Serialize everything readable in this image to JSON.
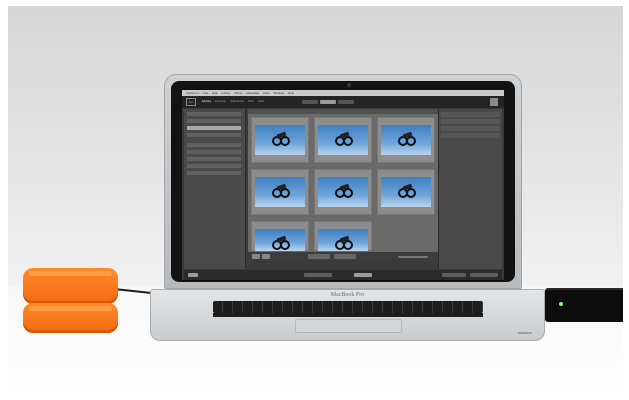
{
  "scene": {
    "description_visible": "",
    "laptop_brand": "MacBook Pro"
  },
  "app": {
    "menu_items": [
      "Lightroom",
      "File",
      "Edit",
      "Library",
      "Photo",
      "Metadata",
      "View",
      "Window",
      "Help"
    ],
    "modules": [
      "Library",
      "Develop",
      "Slideshow",
      "Print",
      "Web"
    ],
    "active_module": "Library",
    "logo_glyph": "Lr"
  },
  "colors": {
    "drive_orange": "#f26a0f",
    "sky_blue": "#6ea4da",
    "ui_dark": "#3a3a3a"
  }
}
